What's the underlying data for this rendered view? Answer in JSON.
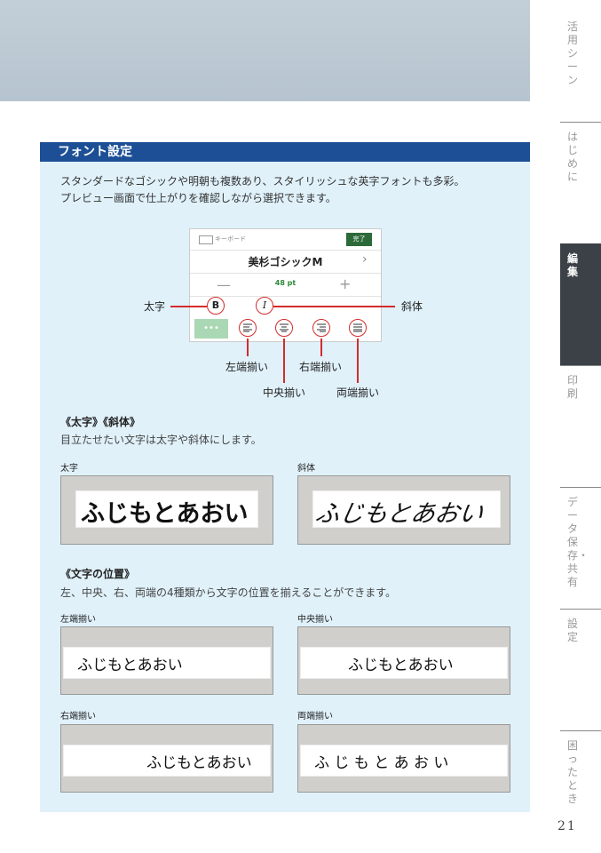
{
  "sidebar": {
    "sections": [
      {
        "label": "活用シーン"
      },
      {
        "label": "はじめに"
      },
      {
        "label": "編集"
      },
      {
        "label": "印刷"
      },
      {
        "label": "データ保存・共有"
      },
      {
        "label": "設定"
      },
      {
        "label": "困ったとき"
      }
    ],
    "page_number": "21"
  },
  "section": {
    "title": "フォント設定",
    "intro_line1": "スタンダードなゴシックや明朝も複数あり、スタイリッシュな英字フォントも多彩。",
    "intro_line2": "プレビュー画面で仕上がりを確認しながら選択できます。"
  },
  "phone": {
    "keyboard_label": "キーボード",
    "done_label": "完了",
    "font_name": "美杉ゴシックM",
    "size_value": "48 pt",
    "minus": "—",
    "plus": "+",
    "dots": "•••",
    "bold_icon": "B",
    "italic_icon": "I"
  },
  "callouts": {
    "bold": "太字",
    "italic": "斜体",
    "left": "左端揃い",
    "right": "右端揃い",
    "center": "中央揃い",
    "justify": "両端揃い"
  },
  "style_section": {
    "heading": "《太字》《斜体》",
    "description": "目立たせたい文字は太字や斜体にします。",
    "bold_caption": "太字",
    "italic_caption": "斜体",
    "sample_text": "ふじもとあおい"
  },
  "position_section": {
    "heading": "《文字の位置》",
    "description": "左、中央、右、両端の4種類から文字の位置を揃えることができます。",
    "left_caption": "左端揃い",
    "center_caption": "中央揃い",
    "right_caption": "右端揃い",
    "justify_caption": "両端揃い",
    "justify_text": "ふ じ も と あ お い"
  }
}
